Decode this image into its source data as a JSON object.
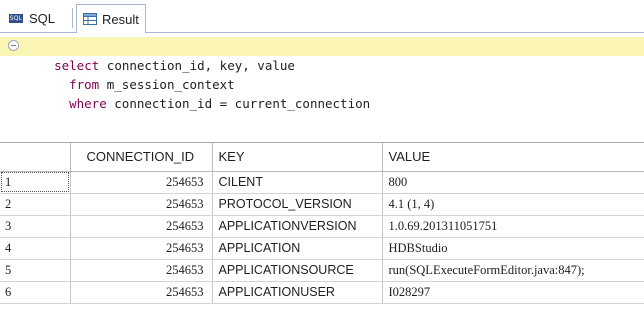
{
  "tabs": [
    {
      "label": "SQL",
      "icon": "sql-icon"
    },
    {
      "label": "Result",
      "icon": "result-table-icon"
    }
  ],
  "editor": {
    "lines": [
      {
        "keyword": "select",
        "text": " connection_id, key, value"
      },
      {
        "keyword": "from",
        "text": " m_session_context"
      },
      {
        "keyword": "where",
        "text": " connection_id = current_connection"
      }
    ],
    "current_line_color": "#fbf5b3",
    "keyword_color": "#7f0055"
  },
  "result": {
    "columns": [
      "",
      "CONNECTION_ID",
      "KEY",
      "VALUE"
    ],
    "rows": [
      [
        "1",
        "254653",
        "CILENT",
        "800"
      ],
      [
        "2",
        "254653",
        "PROTOCOL_VERSION",
        "4.1 (1, 4)"
      ],
      [
        "3",
        "254653",
        "APPLICATIONVERSION",
        "1.0.69.201311051751"
      ],
      [
        "4",
        "254653",
        "APPLICATION",
        "HDBStudio"
      ],
      [
        "5",
        "254653",
        "APPLICATIONSOURCE",
        "run(SQLExecuteFormEditor.java:847);"
      ],
      [
        "6",
        "254653",
        "APPLICATIONUSER",
        "I028297"
      ]
    ]
  }
}
